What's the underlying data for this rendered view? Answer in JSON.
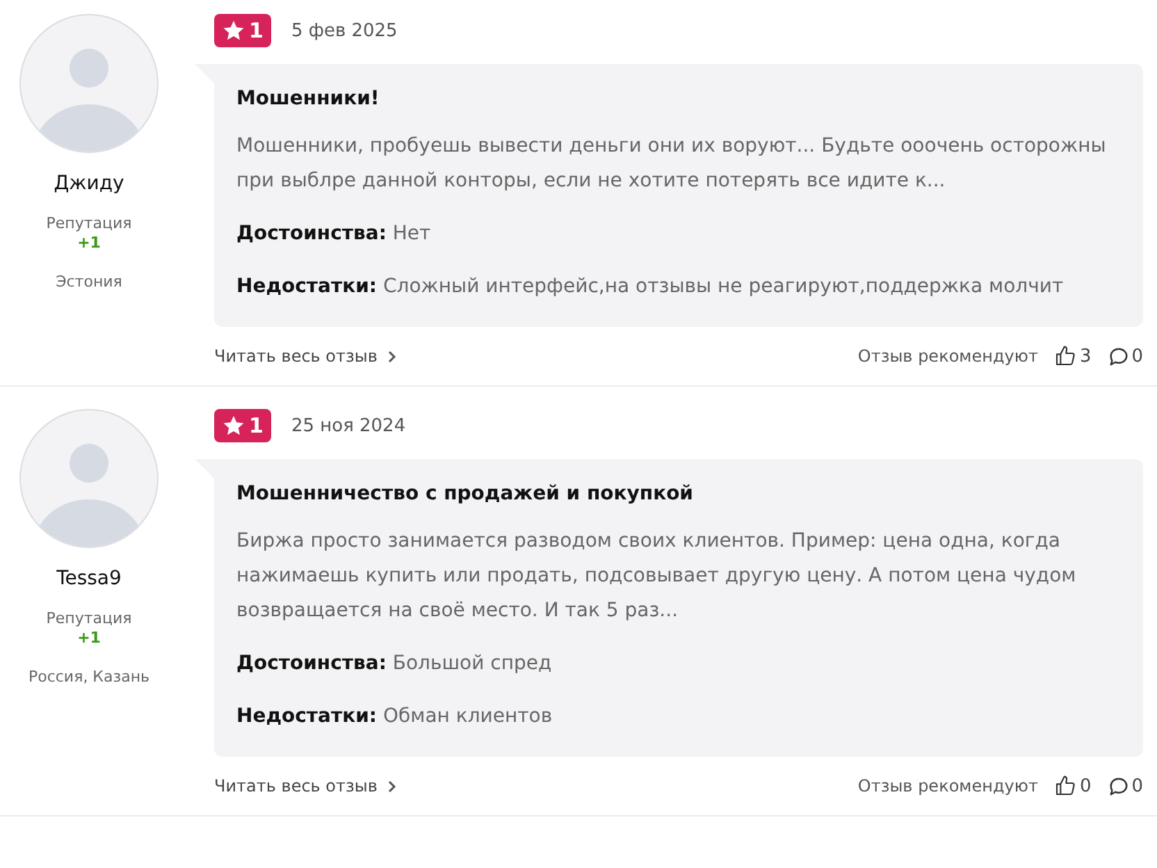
{
  "reviews": [
    {
      "author": {
        "name": "Джиду",
        "reputation_label": "Репутация",
        "reputation": "+1",
        "location": "Эстония"
      },
      "rating": "1",
      "date": "5 фев 2025",
      "title": "Мошенники!",
      "text": "Мошенники, пробуешь вывести деньги они их воруют... Будьте ооочень осторожны при выблре данной конторы, если не хотите потерять все идите к...",
      "pros_label": "Достоинства:",
      "pros": "Нет",
      "cons_label": "Недостатки:",
      "cons": "Сложный интерфейс,на отзывы не реагируют,поддержка молчит",
      "read_more": "Читать весь отзыв",
      "recommend_label": "Отзыв рекомендуют",
      "likes": "3",
      "comments": "0"
    },
    {
      "author": {
        "name": "Tessa9",
        "reputation_label": "Репутация",
        "reputation": "+1",
        "location": "Россия, Казань"
      },
      "rating": "1",
      "date": "25 ноя 2024",
      "title": "Мошенничество с продажей и покупкой",
      "text": "Биржа просто занимается разводом своих клиентов. Пример: цена одна, когда нажимаешь купить или продать, подсовывает другую цену. А потом цена чудом возвращается на своё место. И так 5 раз...",
      "pros_label": "Достоинства:",
      "pros": "Большой спред",
      "cons_label": "Недостатки:",
      "cons": "Обман клиентов",
      "read_more": "Читать весь отзыв",
      "recommend_label": "Отзыв рекомендуют",
      "likes": "0",
      "comments": "0"
    }
  ]
}
